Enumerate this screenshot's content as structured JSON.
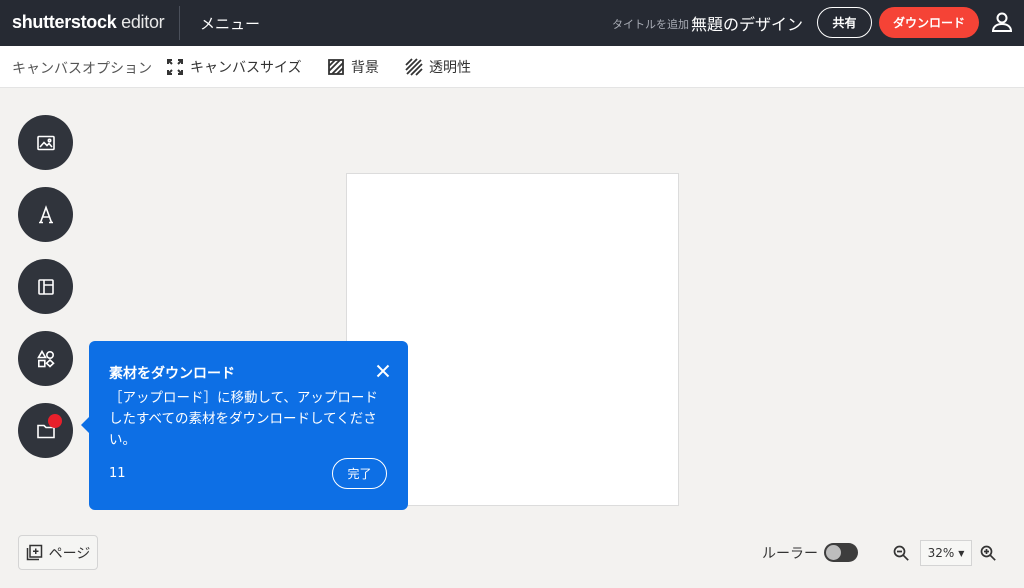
{
  "topbar": {
    "logo_brand": "shutterstock",
    "logo_product": " editor",
    "menu_label": "メニュー",
    "title_hint": "タイトルを追加",
    "design_title": "無題のデザイン",
    "share_label": "共有",
    "download_label": "ダウンロード",
    "bg_color": "#262a33",
    "download_color": "#f54336"
  },
  "canvas_options": {
    "title": "キャンバスオプション",
    "items": [
      {
        "label": "キャンバスサイズ",
        "icon": "expand-corners-icon"
      },
      {
        "label": "背景",
        "icon": "background-hatch-icon"
      },
      {
        "label": "透明性",
        "icon": "transparency-stripes-icon"
      }
    ]
  },
  "tools": [
    {
      "icon": "image-icon"
    },
    {
      "icon": "text-icon"
    },
    {
      "icon": "layout-icon"
    },
    {
      "icon": "elements-icon"
    },
    {
      "icon": "folder-icon",
      "notification": true
    }
  ],
  "tooltip": {
    "title": "素材をダウンロード",
    "body": "［アップロード］に移動して、アップロードしたすべての素材をダウンロードしてください。",
    "count": "11",
    "done_label": "完了",
    "bg_color": "#0d6fe5"
  },
  "bottom": {
    "page_label": "ページ",
    "ruler_label": "ルーラー",
    "ruler_on": false,
    "zoom_value": "32%"
  }
}
